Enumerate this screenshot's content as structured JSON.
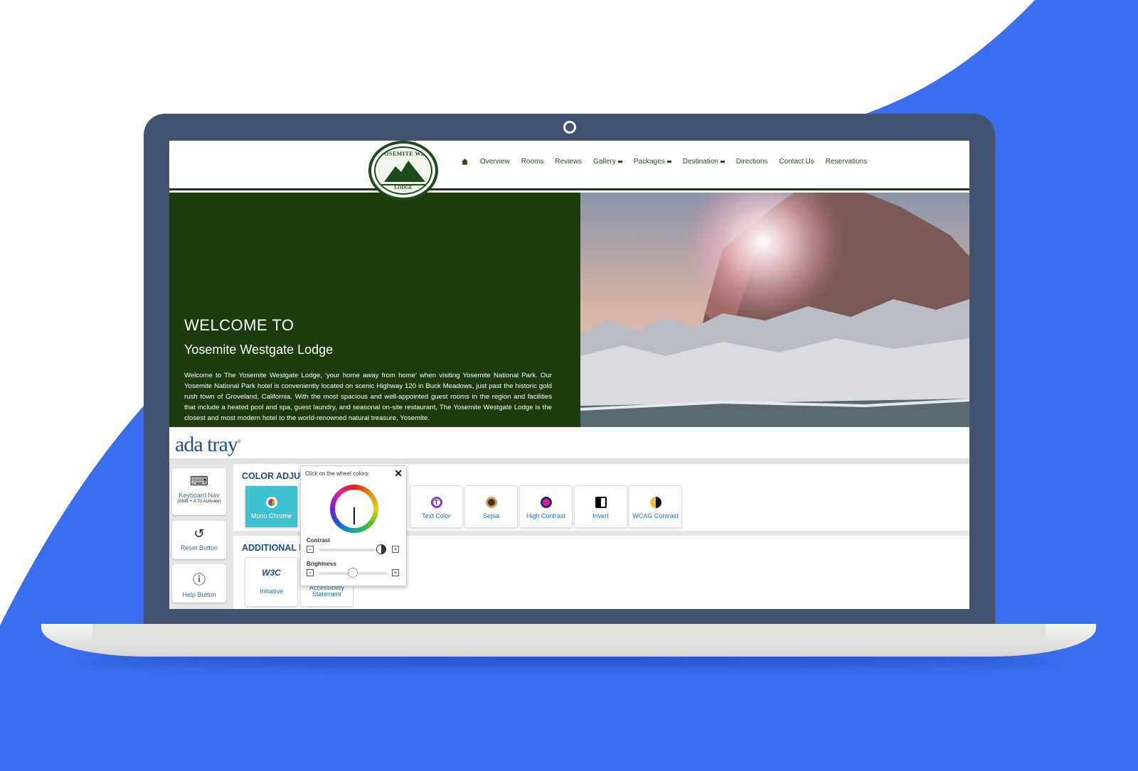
{
  "site": {
    "logo": {
      "top_text": "YOSEMITE WESTGATE",
      "bottom_text": "LODGE"
    },
    "nav": [
      {
        "label": "Overview",
        "dropdown": false
      },
      {
        "label": "Rooms",
        "dropdown": false
      },
      {
        "label": "Reviews",
        "dropdown": false
      },
      {
        "label": "Gallery",
        "dropdown": true
      },
      {
        "label": "Packages",
        "dropdown": true
      },
      {
        "label": "Destination",
        "dropdown": true
      },
      {
        "label": "Directions",
        "dropdown": false
      },
      {
        "label": "Contact Us",
        "dropdown": false
      },
      {
        "label": "Reservations",
        "dropdown": false
      }
    ],
    "home_icon": "home-icon",
    "hero": {
      "heading": "WELCOME TO",
      "subheading": "Yosemite Westgate Lodge",
      "paragraph": "Welcome to The Yosemite Westgate Lodge, 'your home away from home' when visiting Yosemite National Park. Our Yosemite National Park hotel is conveniently located on scenic Highway 120 in Buck Meadows, just past the historic gold rush town of Groveland, California. With the most spacious and well-appointed guest rooms in the region and facilities that include a heated pool and spa, guest laundry, and seasonal on-site restaurant, The Yosemite Westgate Lodge is the closest and most modern hotel to the world-renowned natural treasure, Yosemite."
    }
  },
  "ada_tray": {
    "logo": "ada tray",
    "side_buttons": [
      {
        "label": "Keyboard Nav",
        "sub": "(Shift + A To Activate)",
        "icon": "keyboard-icon"
      },
      {
        "label": "Reset Button",
        "sub": "",
        "icon": "reset-icon"
      },
      {
        "label": "Help Button",
        "sub": "",
        "icon": "info-icon"
      }
    ],
    "color_panel_title": "COLOR ADJUS",
    "color_tools": [
      {
        "label": "Mono Chrome",
        "active": true,
        "color": "#3ec2d2"
      },
      {
        "label": "Text Color",
        "active": false,
        "color": "#333333"
      },
      {
        "label": "Sepia",
        "active": false,
        "color": "#8a6a35"
      },
      {
        "label": "High Contrast",
        "active": false,
        "color": "#e0208a"
      },
      {
        "label": "Invert",
        "active": false,
        "color": "#000000"
      },
      {
        "label": "WCAG Contrast",
        "active": false,
        "color": "#f0c030"
      }
    ],
    "additional_title": "ADDITIONAL I",
    "additional_tools": [
      {
        "label": "Initiative",
        "icon_text": "W3C"
      },
      {
        "label": "Accessibility Statement",
        "icon_text": ""
      }
    ],
    "popup": {
      "title": "Click on the wheel colors:",
      "close": "✕",
      "contrast_label": "Contrast",
      "brightness_label": "Brightness",
      "contrast_level": 0.92,
      "brightness_level": 0.5
    }
  },
  "colors": {
    "brand_green": "#1d3b0c",
    "accent_blue": "#3a6ef0",
    "lid": "#425371"
  }
}
